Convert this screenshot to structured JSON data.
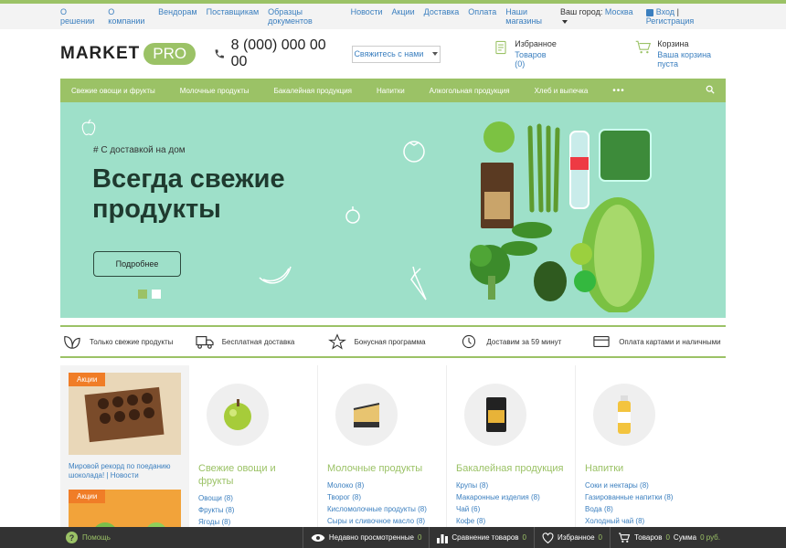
{
  "topnav": [
    "О решении",
    "О компании",
    "Вендорам",
    "Поставщикам",
    "Образцы документов",
    "Новости",
    "Акции",
    "Доставка",
    "Оплата",
    "Наши магазины"
  ],
  "city": {
    "label": "Ваш город:",
    "value": "Москва"
  },
  "auth": {
    "login": "Вход",
    "sep": "|",
    "register": "Регистрация"
  },
  "logo": {
    "market": "MARKET",
    "pro": "PRO"
  },
  "phone": "8 (000) 000 00 00",
  "contact_button": "Свяжитесь с нами",
  "favorites": {
    "title": "Избранное",
    "sub": "Товаров (0)"
  },
  "cart": {
    "title": "Корзина",
    "sub": "Ваша корзина пуста"
  },
  "catnav": [
    "Свежие овощи и фрукты",
    "Молочные продукты",
    "Бакалейная продукция",
    "Напитки",
    "Алкогольная продукция",
    "Хлеб и выпечка"
  ],
  "catnav_more": "•••",
  "hero": {
    "tag": "# С доставкой на дом",
    "title": "Всегда свежие продукты",
    "button": "Подробнее"
  },
  "features": [
    "Только свежие продукты",
    "Бесплатная доставка",
    "Бонусная программа",
    "Доставим за 59 минут",
    "Оплата картами и наличными"
  ],
  "promo": {
    "badge": "Акции",
    "text": "Мировой рекорд по поеданию шоколада!",
    "sep": "|",
    "category": "Новости",
    "badge2": "Акции"
  },
  "categories": [
    {
      "name": "Свежие овощи и фрукты",
      "items": [
        {
          "label": "Овощи",
          "count": "(8)"
        },
        {
          "label": "Фрукты",
          "count": "(8)"
        },
        {
          "label": "Ягоды",
          "count": "(8)"
        }
      ]
    },
    {
      "name": "Молочные продукты",
      "items": [
        {
          "label": "Молоко",
          "count": "(8)"
        },
        {
          "label": "Творог",
          "count": "(8)"
        },
        {
          "label": "Кисломолочные продукты",
          "count": "(8)"
        },
        {
          "label": "Сыры и сливочное масло",
          "count": "(8)"
        }
      ]
    },
    {
      "name": "Бакалейная продукция",
      "items": [
        {
          "label": "Крупы",
          "count": "(8)"
        },
        {
          "label": "Макаронные изделия",
          "count": "(8)"
        },
        {
          "label": "Чай",
          "count": "(6)"
        },
        {
          "label": "Кофе",
          "count": "(8)"
        }
      ]
    },
    {
      "name": "Напитки",
      "items": [
        {
          "label": "Соки и нектары",
          "count": "(8)"
        },
        {
          "label": "Газированные напитки",
          "count": "(8)"
        },
        {
          "label": "Вода",
          "count": "(8)"
        },
        {
          "label": "Холодный чай",
          "count": "(8)"
        }
      ]
    }
  ],
  "bottombar": {
    "help": "Помощь",
    "viewed": {
      "label": "Недавно просмотренные",
      "count": "0"
    },
    "compare": {
      "label": "Сравнение товаров",
      "count": "0"
    },
    "fav": {
      "label": "Избранное",
      "count": "0"
    },
    "goods": {
      "label": "Товаров",
      "count": "0"
    },
    "sum": {
      "label": "Сумма",
      "value": "0 руб."
    }
  },
  "colors": {
    "accent": "#9bc266",
    "link": "#3b7fbf",
    "hero_bg": "#9ee0c9",
    "badge": "#f07d27",
    "bottombar": "#333333"
  }
}
